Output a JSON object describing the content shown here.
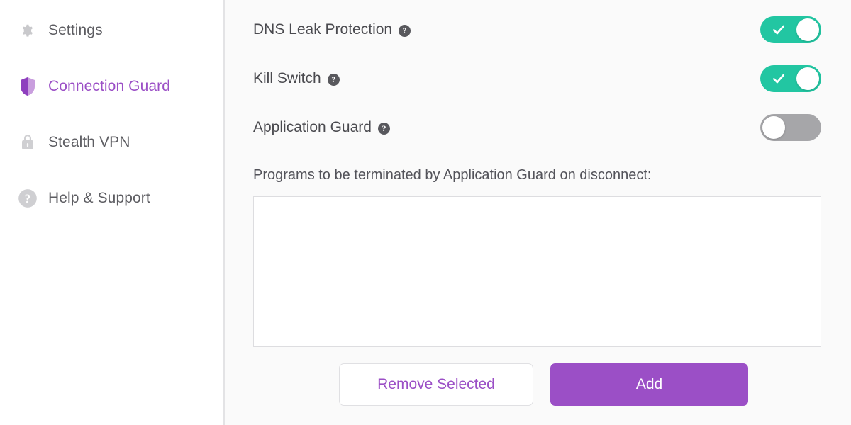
{
  "sidebar": {
    "items": [
      {
        "label": "Settings",
        "icon": "gear-icon",
        "active": false
      },
      {
        "label": "Connection Guard",
        "icon": "shield-icon",
        "active": true
      },
      {
        "label": "Stealth VPN",
        "icon": "lock-icon",
        "active": false
      },
      {
        "label": "Help & Support",
        "icon": "question-circle-icon",
        "active": false
      }
    ]
  },
  "main": {
    "toggles": [
      {
        "label": "DNS Leak Protection",
        "help": "?",
        "state": "on",
        "state_label": "On"
      },
      {
        "label": "Kill Switch",
        "help": "?",
        "state": "on",
        "state_label": "On"
      },
      {
        "label": "Application Guard",
        "help": "?",
        "state": "off",
        "state_label": "Off"
      }
    ],
    "programs_caption": "Programs to be terminated by Application Guard on disconnect:",
    "programs_value": "",
    "programs_placeholder": "",
    "buttons": {
      "remove_label": "Remove Selected",
      "add_label": "Add"
    }
  },
  "colors": {
    "accent_purple": "#9b4fc6",
    "toggle_on_green": "#22c6a2",
    "toggle_off_gray": "#a6a6a9",
    "text_gray": "#5d5d62",
    "panel_bg": "#fafafa"
  }
}
